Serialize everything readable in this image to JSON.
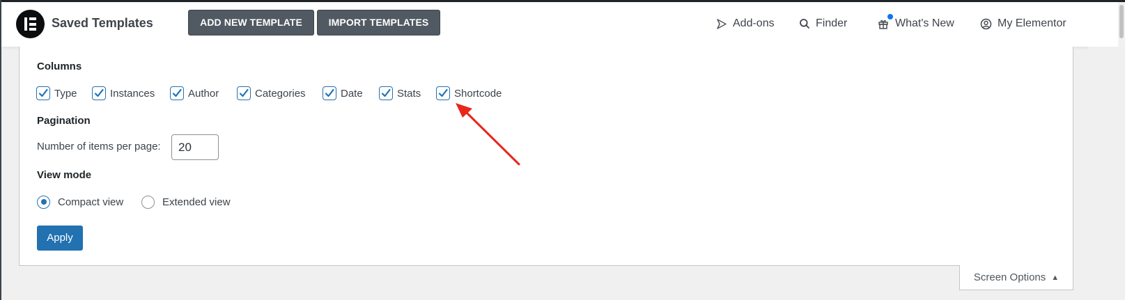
{
  "header": {
    "title": "Saved Templates",
    "add_new_label": "ADD NEW TEMPLATE",
    "import_label": "IMPORT TEMPLATES",
    "nav": {
      "addons": "Add-ons",
      "finder": "Finder",
      "whats_new": "What's New",
      "my_elementor": "My Elementor"
    }
  },
  "screen_options": {
    "columns_heading": "Columns",
    "columns": [
      {
        "label": "Type",
        "checked": true
      },
      {
        "label": "Instances",
        "checked": true
      },
      {
        "label": "Author",
        "checked": true
      },
      {
        "label": "Categories",
        "checked": true
      },
      {
        "label": "Date",
        "checked": true
      },
      {
        "label": "Stats",
        "checked": true
      },
      {
        "label": "Shortcode",
        "checked": true
      }
    ],
    "pagination_heading": "Pagination",
    "per_page_label": "Number of items per page:",
    "per_page_value": "20",
    "view_mode_heading": "View mode",
    "view_modes": [
      {
        "label": "Compact view",
        "selected": true
      },
      {
        "label": "Extended view",
        "selected": false
      }
    ],
    "apply_label": "Apply",
    "tab_label": "Screen Options"
  },
  "icons": {
    "logo": "elementor-logo",
    "addons": "send-arrow-icon",
    "finder": "search-icon",
    "whats_new": "gift-icon",
    "my_elementor": "user-circle-icon",
    "annotation": "red-arrow"
  },
  "colors": {
    "primary_blue": "#2271b1",
    "toolbar_button": "#515962",
    "annotation_red": "#e8271c",
    "notification_blue": "#0e74f2"
  }
}
